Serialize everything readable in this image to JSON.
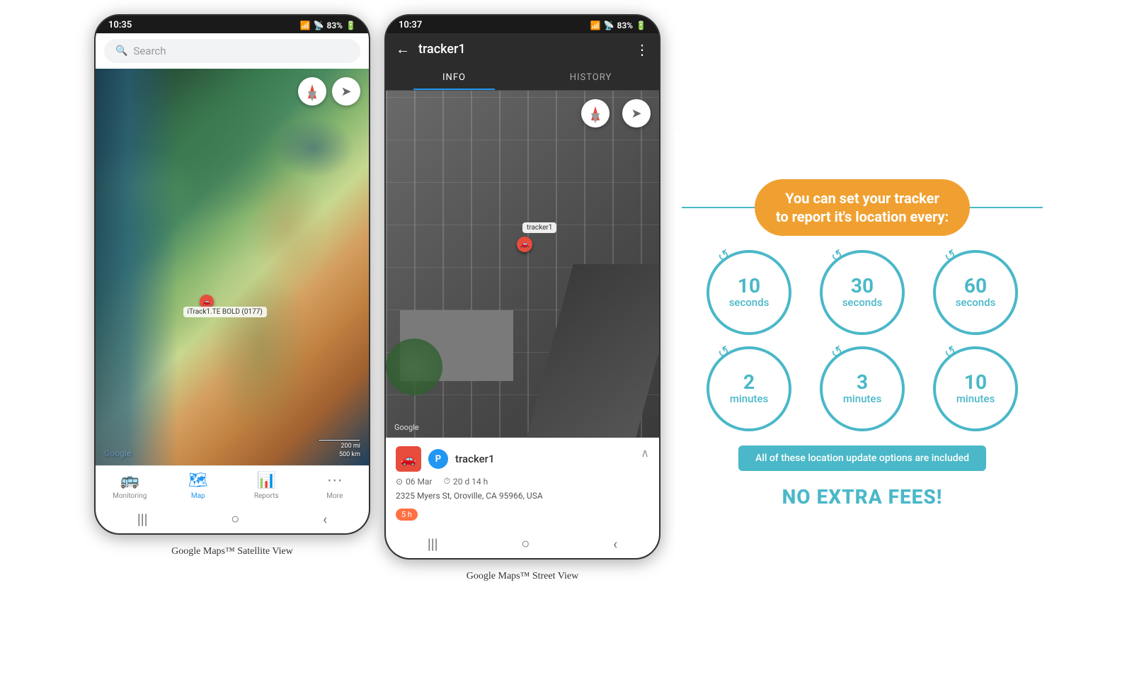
{
  "phone1": {
    "status_time": "10:35",
    "status_signal": "▲▲▲",
    "status_battery": "83%",
    "search_placeholder": "Search",
    "map_watermark": "Google",
    "scale_200mi": "200 mi",
    "scale_500km": "500 km",
    "car_label": "iTrack1.TE BOLD (0177)",
    "nav_items": [
      {
        "icon": "🚌",
        "label": "Monitoring",
        "active": false
      },
      {
        "icon": "🗺",
        "label": "Map",
        "active": true
      },
      {
        "icon": "📊",
        "label": "Reports",
        "active": false
      },
      {
        "icon": "•••",
        "label": "More",
        "active": false
      }
    ],
    "caption": "Google Maps™ Satellite View"
  },
  "phone2": {
    "status_time": "10:37",
    "status_signal": "▲▲▲",
    "status_battery": "83%",
    "tracker_name": "tracker1",
    "tabs": [
      "INFO",
      "HISTORY"
    ],
    "active_tab": "INFO",
    "map_watermark": "Google",
    "tracker_label_map": "tracker1",
    "info": {
      "name": "tracker1",
      "date": "06 Mar",
      "duration": "20 d 14 h",
      "address": "2325 Myers St, Oroville, CA 95966, USA",
      "time_badge": "5 h"
    },
    "caption": "Google Maps™ Street View"
  },
  "info_panel": {
    "title_line1": "You can set your tracker",
    "title_line2": "to report it's location every:",
    "intervals": [
      {
        "number": "10",
        "unit": "seconds"
      },
      {
        "number": "30",
        "unit": "seconds"
      },
      {
        "number": "60",
        "unit": "seconds"
      },
      {
        "number": "2",
        "unit": "minutes"
      },
      {
        "number": "3",
        "unit": "minutes"
      },
      {
        "number": "10",
        "unit": "minutes"
      }
    ],
    "included_text": "All of these location update options are included",
    "no_fees_text": "NO EXTRA FEES!",
    "accent_color": "#4ab8c8",
    "title_bg": "#f0a030"
  }
}
